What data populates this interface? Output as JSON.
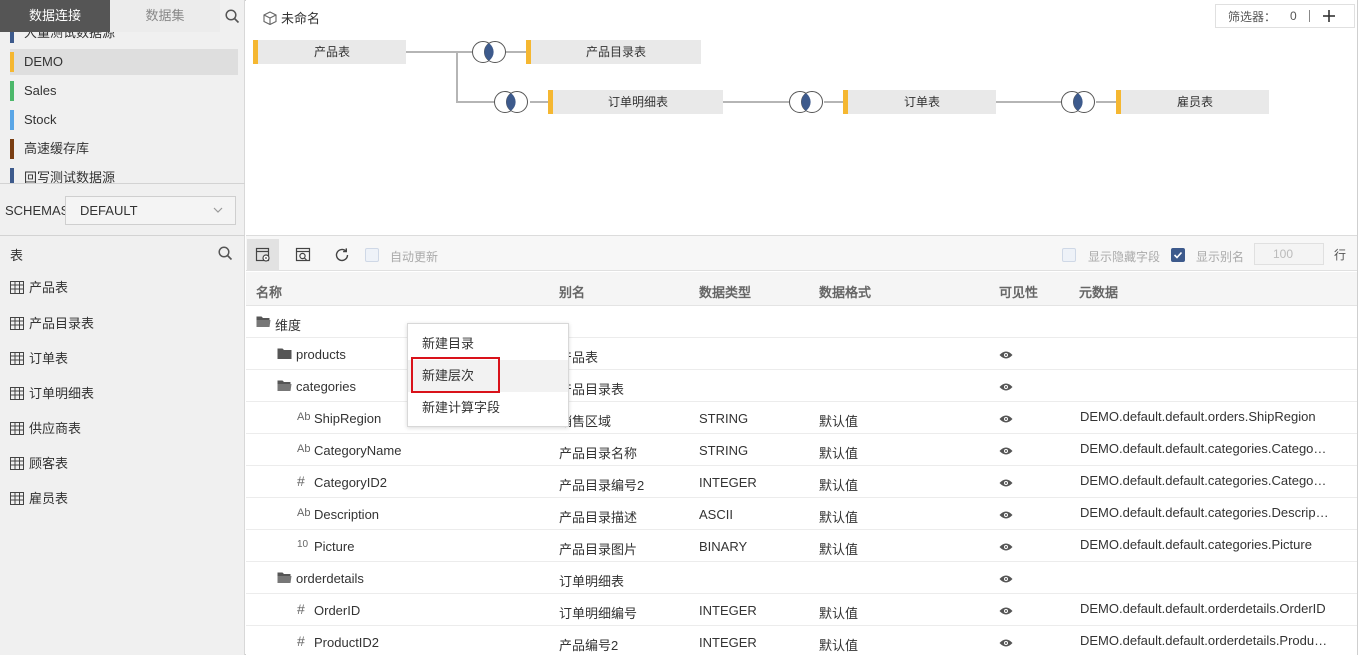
{
  "left": {
    "tabs": {
      "connection": "数据连接",
      "dataset": "数据集"
    },
    "datasources": [
      {
        "label": "大量测试数据源",
        "color": "#3d5a8c"
      },
      {
        "label": "DEMO",
        "color": "#f5b731",
        "active": true
      },
      {
        "label": "Sales",
        "color": "#4cb86b"
      },
      {
        "label": "Stock",
        "color": "#5aa6e6"
      },
      {
        "label": "高速缓存库",
        "color": "#7a3e12"
      },
      {
        "label": "回写测试数据源",
        "color": "#3d5a8c"
      }
    ],
    "schemas": {
      "label": "SCHEMAS",
      "value": "DEFAULT"
    },
    "tables_title": "表",
    "tables": [
      "产品表",
      "产品目录表",
      "订单表",
      "订单明细表",
      "供应商表",
      "顾客表",
      "雇员表"
    ]
  },
  "diagram": {
    "title": "未命名",
    "filter": {
      "label": "筛选器：",
      "count": "0"
    },
    "nodes": {
      "n1": "产品表",
      "n2": "产品目录表",
      "n3": "订单明细表",
      "n4": "订单表",
      "n5": "雇员表"
    },
    "colors": {
      "node_accent": "#f5b731",
      "join_fill": "#3d5a8c"
    }
  },
  "toolbar": {
    "auto_update": "自动更新",
    "show_hidden": "显示隐藏字段",
    "show_alias": "显示别名",
    "rows_value": "100",
    "rows_unit": "行"
  },
  "grid": {
    "headers": {
      "name": "名称",
      "alias": "别名",
      "type": "数据类型",
      "format": "数据格式",
      "visible": "可见性",
      "meta": "元数据"
    },
    "root": "维度",
    "rows": {
      "r1": {
        "name": "products",
        "alias": "产品表"
      },
      "r2": {
        "name": "categories",
        "alias": "产品目录表"
      },
      "r3": {
        "icon": "Ab",
        "name": "ShipRegion",
        "alias": "销售区域",
        "type": "STRING",
        "format": "默认值",
        "meta": "DEMO.default.default.orders.ShipRegion"
      },
      "r4": {
        "icon": "Ab",
        "name": "CategoryName",
        "alias": "产品目录名称",
        "type": "STRING",
        "format": "默认值",
        "meta": "DEMO.default.default.categories.CategoryName"
      },
      "r5": {
        "icon": "#",
        "name": "CategoryID2",
        "alias": "产品目录编号2",
        "type": "INTEGER",
        "format": "默认值",
        "meta": "DEMO.default.default.categories.CategoryID"
      },
      "r6": {
        "icon": "Ab",
        "name": "Description",
        "alias": "产品目录描述",
        "type": "ASCII",
        "format": "默认值",
        "meta": "DEMO.default.default.categories.Description"
      },
      "r7": {
        "icon": "10",
        "name": "Picture",
        "alias": "产品目录图片",
        "type": "BINARY",
        "format": "默认值",
        "meta": "DEMO.default.default.categories.Picture"
      },
      "r8": {
        "name": "orderdetails",
        "alias": "订单明细表"
      },
      "r9": {
        "icon": "#",
        "name": "OrderID",
        "alias": "订单明细编号",
        "type": "INTEGER",
        "format": "默认值",
        "meta": "DEMO.default.default.orderdetails.OrderID"
      },
      "r10": {
        "icon": "#",
        "name": "ProductID2",
        "alias": "产品编号2",
        "type": "INTEGER",
        "format": "默认值",
        "meta": "DEMO.default.default.orderdetails.ProductID"
      }
    }
  },
  "context_menu": {
    "items": [
      "新建目录",
      "新建层次",
      "新建计算字段"
    ],
    "highlight_color": "#d9121a"
  }
}
